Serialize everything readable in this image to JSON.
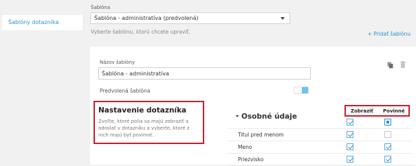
{
  "sidebar": {
    "items": [
      {
        "label": "Šablóny dotazníka"
      }
    ]
  },
  "template_select": {
    "label": "Šablóna",
    "value": "Šablóna - administratíva (predvolená)",
    "hint": "Vyberte šablónu, ktorú chcete upraviť."
  },
  "actions": {
    "add_template": "+ Pridať šablónu"
  },
  "editor": {
    "name_label": "Názov šablóny",
    "name_value": "Šablóna - administratíva",
    "default_label": "Predvolená šablóna",
    "default_on": true
  },
  "settings": {
    "title": "Nastavenie dotazníka",
    "description": "Zvoľte, ktoré polia sa majú zobraziť a odoslať v dotazníku a vyberte, ktoré z nich majú byť povinné."
  },
  "personal": {
    "title": "Osobné údaje",
    "col_show": "Zobraziť",
    "col_required": "Povinné",
    "rows": [
      {
        "label": "",
        "show": true,
        "required": "filled"
      },
      {
        "label": "Titul pred menom",
        "show": true,
        "required": "none"
      },
      {
        "label": "Meno",
        "show": true,
        "required": "checked"
      },
      {
        "label": "Priezvisko",
        "show": true,
        "required": "checked"
      }
    ]
  },
  "colors": {
    "accent": "#2a8fd4",
    "highlight": "#d0182b"
  },
  "icons": [
    "copy-icon",
    "trash-icon",
    "chevron-down-icon",
    "checkbox-checked-icon"
  ]
}
